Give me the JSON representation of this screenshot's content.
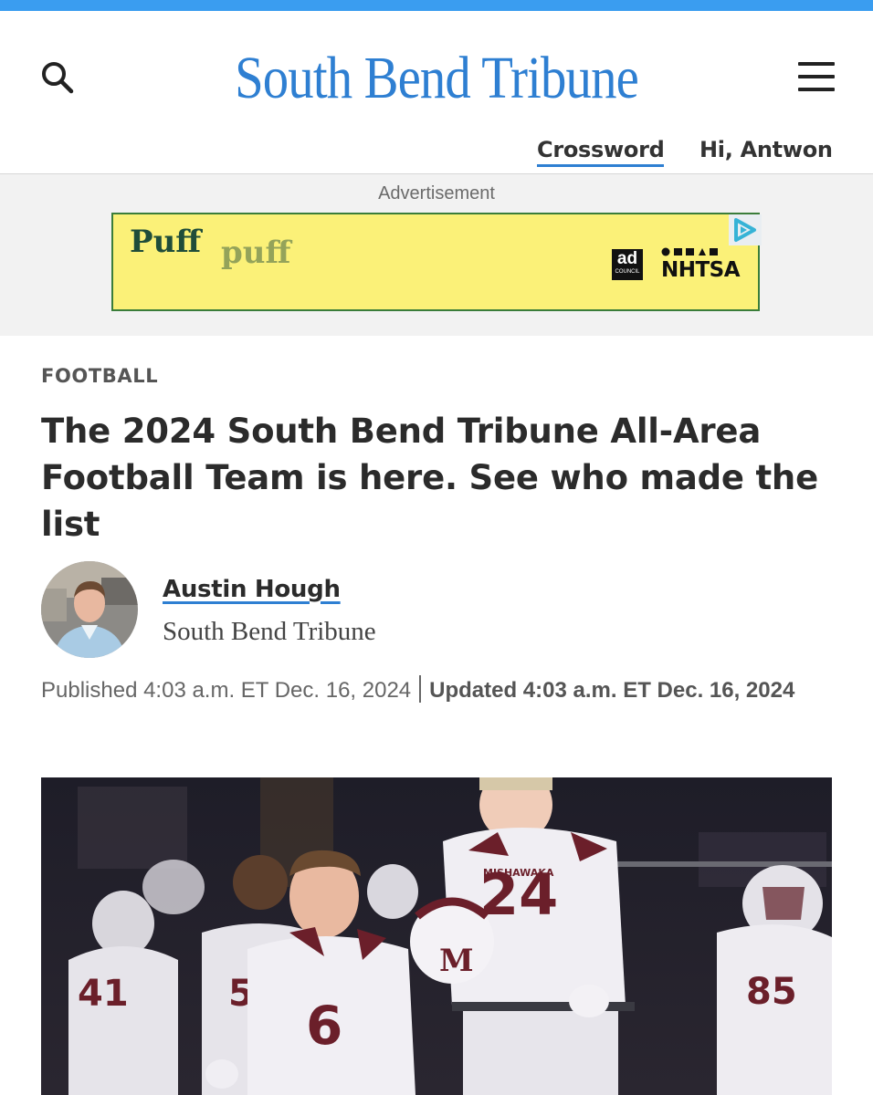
{
  "header": {
    "logo": "South Bend Tribune",
    "crossword": "Crossword",
    "greeting": "Hi, Antwon",
    "search_icon": "search-icon",
    "menu_icon": "hamburger-menu-icon"
  },
  "ad": {
    "label": "Advertisement",
    "headline_1": "Puff",
    "headline_2": "puff",
    "ad_council_big": "ad",
    "ad_council_small": "COUNCIL",
    "sponsor": "NHTSA",
    "adchoices_icon": "adchoices-icon"
  },
  "article": {
    "section": "FOOTBALL",
    "headline": "The 2024 South Bend Tribune All-Area Football Team is here. See who made the list",
    "author": "Austin Hough",
    "outlet": "South Bend Tribune",
    "published": "Published 4:03 a.m. ET Dec. 16, 2024",
    "updated": "Updated 4:03 a.m. ET Dec. 16, 2024"
  },
  "photo": {
    "team": "MISHAWAKA",
    "numbers": [
      "41",
      "57",
      "6",
      "24",
      "85"
    ],
    "helmet_letter": "M"
  },
  "colors": {
    "brand_blue": "#2e7fd2",
    "top_bar": "#3a9df0",
    "ad_yellow": "#fbf178",
    "maroon": "#6b1f2a"
  }
}
